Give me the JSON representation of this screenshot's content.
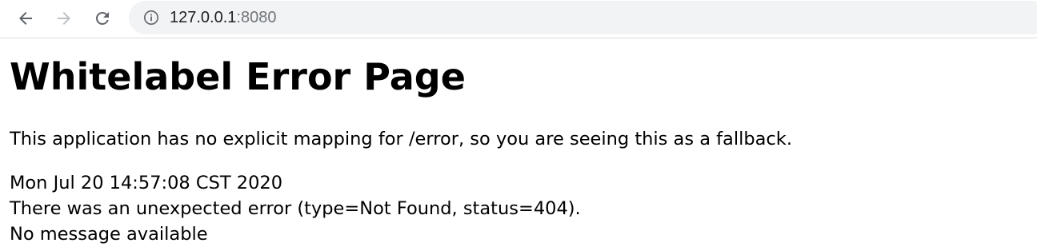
{
  "browser": {
    "url_host": "127.0.0.1",
    "url_port": ":8080",
    "icons": {
      "back": "arrow-left-icon",
      "forward": "arrow-right-icon",
      "reload": "reload-icon",
      "site_info": "info-icon"
    }
  },
  "page": {
    "title": "Whitelabel Error Page",
    "description": "This application has no explicit mapping for /error, so you are seeing this as a fallback.",
    "timestamp": "Mon Jul 20 14:57:08 CST 2020",
    "error": "There was an unexpected error (type=Not Found, status=404).",
    "message": "No message available"
  },
  "colors": {
    "toolbar_icon": "#5f6368",
    "toolbar_icon_disabled": "#bdc1c6",
    "omnibox_bg": "#f1f3f4",
    "url_port": "#70757a"
  }
}
